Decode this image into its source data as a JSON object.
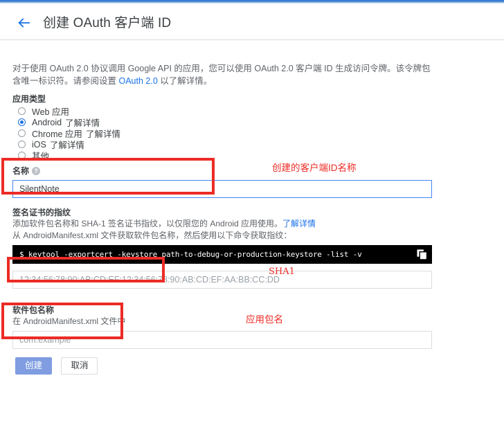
{
  "header": {
    "back_icon": "arrow-left-icon",
    "title": "创建 OAuth 客户端 ID"
  },
  "intro": {
    "part1": "对于使用 OAuth 2.0 协议调用 Google API 的应用，您可以使用 OAuth 2.0 客户端 ID 生成访问令牌。该令牌包含唯一标识符。请参阅设置 ",
    "link": "OAuth 2.0",
    "part2": " 以了解详情。"
  },
  "app_type": {
    "label": "应用类型",
    "options": [
      {
        "label": "Web 应用",
        "link": "",
        "checked": false
      },
      {
        "label": "Android",
        "link": "了解详情",
        "checked": true
      },
      {
        "label": "Chrome 应用",
        "link": "了解详情",
        "checked": false
      },
      {
        "label": "iOS",
        "link": "了解详情",
        "checked": false
      },
      {
        "label": "其他",
        "link": "",
        "checked": false
      }
    ]
  },
  "name_section": {
    "label": "名称",
    "help_icon": "help-icon",
    "value": "SilentNote",
    "placeholder": ""
  },
  "fingerprint_section": {
    "label": "签名证书的指纹",
    "desc1": "添加软件包名称和 SHA-1 签名证书指纹，以仅限您的 Android 应用使用。",
    "desc1_link": "了解详情",
    "desc2": "从 AndroidManifest.xml 文件获取软件包名称，然后使用以下命令获取指纹：",
    "command": "$ keytool -exportcert -keystore path-to-debug-or-production-keystore -list -v",
    "copy_icon": "copy-icon",
    "sha1_placeholder": "12:34:56:78:90:AB:CD:EF:12:34:56:78:90:AB:CD:EF:AA:BB:CC:DD",
    "sha1_value": ""
  },
  "package_section": {
    "label": "软件包名称",
    "desc": "在 AndroidManifest.xml 文件中",
    "placeholder": "com.example",
    "value": ""
  },
  "buttons": {
    "create": "创建",
    "cancel": "取消"
  },
  "annotations": {
    "name": "创建的客户端ID名称",
    "sha1": "SHA1",
    "package": "应用包名",
    "color": "#ec2b25"
  },
  "colors": {
    "accent": "#1a73e8",
    "link": "#1a73e8",
    "primary_button": "#7f9de0",
    "annotation_red": "#ec2b25",
    "text": "#3c4043",
    "muted_text": "#5f6368"
  }
}
